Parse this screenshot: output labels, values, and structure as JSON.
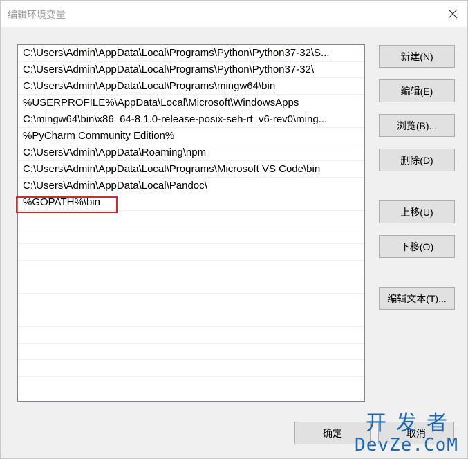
{
  "window": {
    "title": "编辑环境变量"
  },
  "paths": [
    "C:\\Users\\Admin\\AppData\\Local\\Programs\\Python\\Python37-32\\S...",
    "C:\\Users\\Admin\\AppData\\Local\\Programs\\Python\\Python37-32\\",
    "C:\\Users\\Admin\\AppData\\Local\\Programs\\mingw64\\bin",
    "%USERPROFILE%\\AppData\\Local\\Microsoft\\WindowsApps",
    "C:\\mingw64\\bin\\x86_64-8.1.0-release-posix-seh-rt_v6-rev0\\ming...",
    "%PyCharm Community Edition%",
    "C:\\Users\\Admin\\AppData\\Roaming\\npm",
    "C:\\Users\\Admin\\AppData\\Local\\Programs\\Microsoft VS Code\\bin",
    "C:\\Users\\Admin\\AppData\\Local\\Pandoc\\",
    "%GOPATH%\\bin"
  ],
  "buttons": {
    "new": "新建(N)",
    "edit": "编辑(E)",
    "browse": "浏览(B)...",
    "delete": "删除(D)",
    "move_up": "上移(U)",
    "move_down": "下移(O)",
    "edit_text": "编辑文本(T)...",
    "ok": "确定",
    "cancel": "取消"
  },
  "watermark": {
    "cn": "开发者",
    "en": "DevZe.CoM"
  },
  "colors": {
    "highlight_border": "#e3212a",
    "watermark": "#1a66b8"
  }
}
